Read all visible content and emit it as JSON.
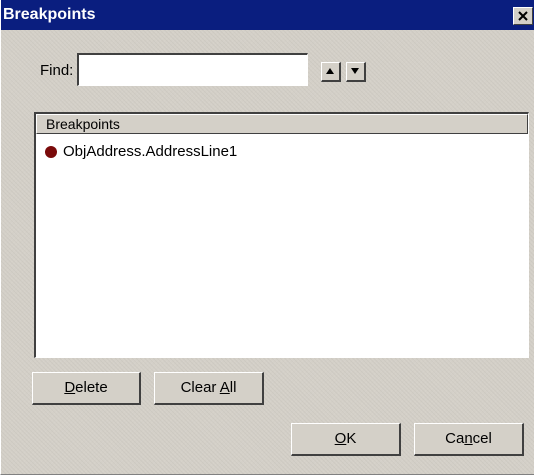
{
  "window": {
    "title": "Breakpoints",
    "close_icon": "close-x-icon"
  },
  "find": {
    "label": "Find:",
    "value": "",
    "placeholder": "",
    "up_icon": "arrow-up-icon",
    "down_icon": "arrow-down-icon"
  },
  "list": {
    "header": "Breakpoints",
    "items": [
      {
        "marker_icon": "breakpoint-dot-icon",
        "marker_color": "#7a0a0a",
        "label": "ObjAddress.AddressLine1"
      }
    ]
  },
  "buttons": {
    "delete": {
      "mnemonic": "D",
      "rest": "elete"
    },
    "clear_all": {
      "before": "Clear ",
      "mnemonic": "A",
      "rest": "ll"
    },
    "ok": {
      "mnemonic": "O",
      "rest": "K"
    },
    "cancel": {
      "before": "Ca",
      "mnemonic": "n",
      "rest": "cel"
    }
  },
  "colors": {
    "titlebar": "#0a1e7f",
    "face": "#d4d0c8"
  }
}
